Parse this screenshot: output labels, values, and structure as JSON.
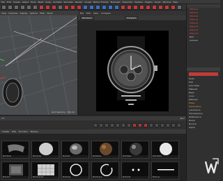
{
  "menu": [
    "File",
    "Edit",
    "Create",
    "Select",
    "Tools",
    "Mesh",
    "Snap",
    "Animate",
    "Simulate",
    "Render",
    "Sculpt",
    "Motion Tracker",
    "MoGraph",
    "Character",
    "Pipeline",
    "Plugins",
    "Script",
    "Window",
    "Help"
  ],
  "viewport": {
    "menu": [
      "View",
      "Cameras",
      "Display",
      "Options",
      "Filter",
      "Panel"
    ],
    "grid_label": "Grid Spacing : 100 cm"
  },
  "render_view": {
    "menu": [
      "File",
      "Edit",
      "View",
      "Compare"
    ],
    "dropdown_left": "Renderer",
    "dropdown_right": "Compare"
  },
  "objects": [
    "Material",
    "Material",
    "Material",
    "Material",
    "Material",
    "Material",
    "Material",
    "Material"
  ],
  "objects_white": [
    "Null",
    "Camera"
  ],
  "attributes": [
    "Mode",
    "Edit",
    "User Data",
    "Material",
    "Basic",
    "Color",
    "Diffusion",
    "Luminance",
    "Transparency",
    "Reflectance",
    "Bump",
    "Normal",
    "Alpha"
  ],
  "attributes_orange": [
    "Editor",
    "Illumination"
  ],
  "timeline": {
    "start": "0 F",
    "end": "90 F"
  },
  "materials": {
    "menu": [
      "Create",
      "Edit",
      "Function",
      "Texture"
    ],
    "items": [
      "Mat.Strap",
      "Mat.Glass",
      "Mat.Dial",
      "Mat.Bezel",
      "Mat.Metal",
      "Mat.White",
      "Mat.Grid",
      "Mat.Checker",
      "Mat.Ring",
      "Mat.Ring.1",
      "Mat.Dots",
      "Mat.Line"
    ]
  },
  "colors": {
    "accent_red": "#c23b3b",
    "panel": "#2b2b2b",
    "attr_orange": "#e0a040"
  }
}
